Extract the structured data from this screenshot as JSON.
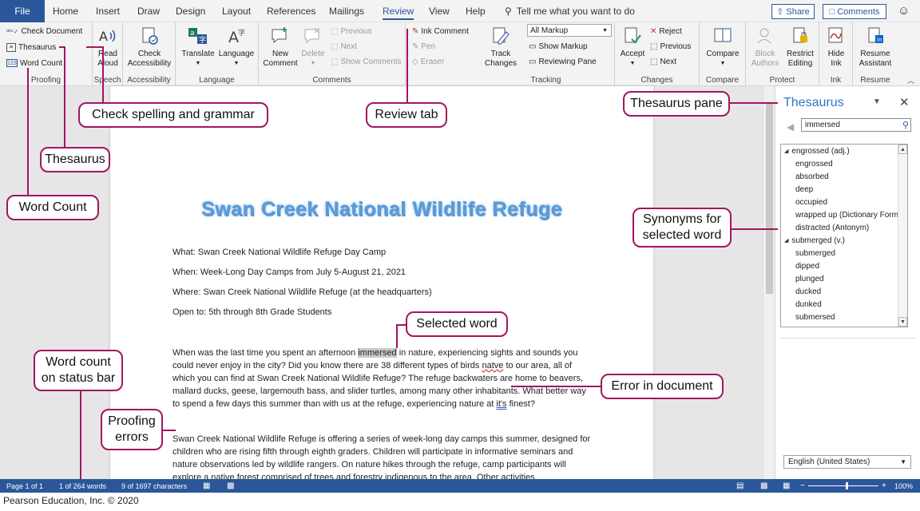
{
  "tabs": {
    "file": "File",
    "items": [
      "Home",
      "Insert",
      "Draw",
      "Design",
      "Layout",
      "References",
      "Mailings",
      "Review",
      "View",
      "Help"
    ],
    "active": "Review",
    "tell_me": "Tell me what you want to do",
    "share": "Share",
    "comments": "Comments"
  },
  "ribbon": {
    "proofing": {
      "label": "Proofing",
      "check_document": "Check Document",
      "thesaurus": "Thesaurus",
      "word_count": "Word Count"
    },
    "speech": {
      "label": "Speech",
      "read_aloud_1": "Read",
      "read_aloud_2": "Aloud"
    },
    "accessibility": {
      "label": "Accessibility",
      "check_1": "Check",
      "check_2": "Accessibility"
    },
    "language": {
      "label": "Language",
      "translate": "Translate",
      "language": "Language"
    },
    "comments": {
      "label": "Comments",
      "new_1": "New",
      "new_2": "Comment",
      "delete": "Delete",
      "previous": "Previous",
      "next": "Next",
      "show_comments": "Show Comments"
    },
    "ink": {
      "ink_comment": "Ink Comment",
      "pen": "Pen",
      "eraser": "Eraser"
    },
    "tracking": {
      "label": "Tracking",
      "track_1": "Track",
      "track_2": "Changes",
      "markup_select": "All Markup",
      "show_markup": "Show Markup",
      "reviewing_pane": "Reviewing Pane"
    },
    "changes": {
      "label": "Changes",
      "accept": "Accept",
      "reject": "Reject",
      "previous": "Previous",
      "next": "Next"
    },
    "compare": {
      "label": "Compare",
      "compare": "Compare"
    },
    "protect": {
      "label": "Protect",
      "block_1": "Block",
      "block_2": "Authors",
      "restrict_1": "Restrict",
      "restrict_2": "Editing"
    },
    "ink_group": {
      "label": "Ink",
      "hide_1": "Hide",
      "hide_2": "Ink"
    },
    "resume": {
      "label": "Resume",
      "resume_1": "Resume",
      "resume_2": "Assistant"
    }
  },
  "document": {
    "title": "Swan Creek National Wildlife Refuge",
    "what": "What: Swan Creek National Wildlife Refuge Day Camp",
    "when": "When: Week-Long Day Camps from July 5-August 21, 2021",
    "where": "Where: Swan Creek National Wildlife Refuge (at the headquarters)",
    "open_to": "Open to: 5th through 8th Grade Students",
    "p1_a": "When was the last time you spent an afternoon ",
    "p1_selected": "immersed",
    "p1_b": " in nature, experiencing sights and sounds you could never enjoy in the city? Did you know there are 38 different types of birds ",
    "p1_error": "natve",
    "p1_c": " to our area, all of which you can find at Swan Creek National Wildlife Refuge? The refuge backwaters are home to beavers, mallard ducks, geese, largemouth bass, and slider turtles, among many other inhabitants. What better way to spend a few days this summer than with us at the refuge, experiencing nature at ",
    "p1_error2": "it's",
    "p1_d": " finest?",
    "p2": "Swan Creek National Wildlife Refuge is offering a series of week-long day camps this summer, designed for children who are rising fifth through eighth graders. Children will participate in informative seminars and nature observations led by wildlife rangers. On nature hikes through the refuge, camp participants will explore a native forest comprised of trees and forestry indigenous to the area. Other activities"
  },
  "thesaurus": {
    "title": "Thesaurus",
    "search_value": "immersed",
    "items": [
      {
        "text": "engrossed (adj.)",
        "head": true
      },
      {
        "text": "engrossed",
        "head": false
      },
      {
        "text": "absorbed",
        "head": false
      },
      {
        "text": "deep",
        "head": false
      },
      {
        "text": "occupied",
        "head": false
      },
      {
        "text": "wrapped up (Dictionary Form)",
        "head": false
      },
      {
        "text": "distracted (Antonym)",
        "head": false
      },
      {
        "text": "submerged (v.)",
        "head": true
      },
      {
        "text": "submerged",
        "head": false
      },
      {
        "text": "dipped",
        "head": false
      },
      {
        "text": "plunged",
        "head": false
      },
      {
        "text": "ducked",
        "head": false
      },
      {
        "text": "dunked",
        "head": false
      },
      {
        "text": "submersed",
        "head": false
      }
    ],
    "language": "English (United States)"
  },
  "status": {
    "page": "Page 1 of 1",
    "words": "1 of 264 words",
    "characters": "9 of 1697 characters",
    "zoom": "100%",
    "zoom_level": 0.55
  },
  "callouts": {
    "check_spelling": "Check spelling and grammar",
    "review_tab": "Review tab",
    "thesaurus_pane": "Thesaurus pane",
    "thesaurus": "Thesaurus",
    "word_count": "Word Count",
    "synonyms_1": "Synonyms for",
    "synonyms_2": "selected word",
    "selected_word": "Selected word",
    "word_count_status_1": "Word count",
    "word_count_status_2": "on status bar",
    "error_in_document": "Error in document",
    "proofing_errors_1": "Proofing",
    "proofing_errors_2": "errors"
  },
  "credit": "Pearson Education, Inc. © 2020",
  "colors": {
    "word_blue": "#2b579a",
    "callout_border": "#a3155f",
    "title_blue": "#5b9bd5"
  }
}
